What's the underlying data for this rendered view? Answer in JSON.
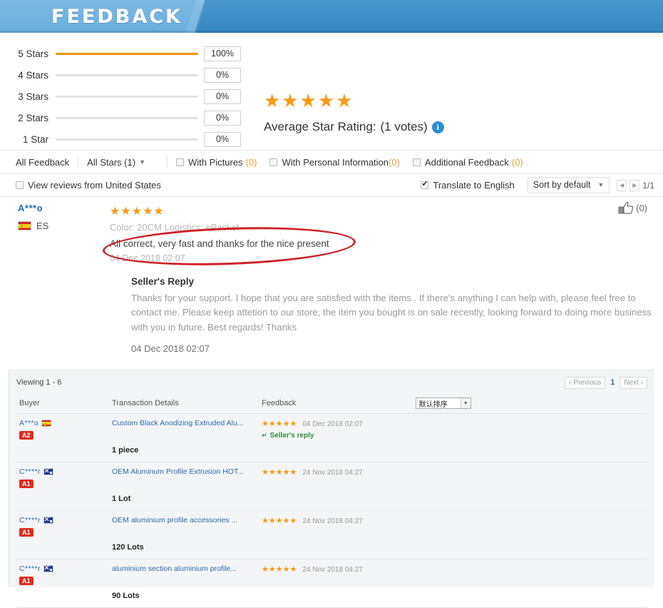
{
  "header": {
    "title": "FEEDBACK",
    "accent": "#3c8dc5",
    "accent_light": "#7cb9e2"
  },
  "summary": {
    "rating_breakdown": [
      {
        "label": "5 Stars",
        "percent_label": "100%",
        "percent": 100
      },
      {
        "label": "4 Stars",
        "percent_label": "0%",
        "percent": 0
      },
      {
        "label": "3 Stars",
        "percent_label": "0%",
        "percent": 0
      },
      {
        "label": "2 Stars",
        "percent_label": "0%",
        "percent": 0
      },
      {
        "label": "1 Star",
        "percent_label": "0%",
        "percent": 0
      }
    ],
    "average_stars": "★★★★★",
    "average_label": "Average Star Rating:",
    "votes_label": "(1 votes)",
    "info_icon": "info-icon",
    "star_color": "#f79a16",
    "bar_color": "#f0920b"
  },
  "filters": {
    "all_feedback": "All Feedback",
    "all_stars": "All Stars (1)",
    "with_pictures": "With Pictures",
    "with_pictures_count": "(0)",
    "with_personal_info": "With Personal Information",
    "with_personal_info_count": "(0)",
    "additional_feedback": "Additional Feedback",
    "additional_feedback_count": "(0)"
  },
  "subbar": {
    "view_reviews_country": "View reviews from United States",
    "translate": "Translate to English",
    "sort": "Sort by default",
    "page_indicator": "1/1"
  },
  "review": {
    "buyer": "A***o",
    "country_code": "ES",
    "stars": "★★★★★",
    "attributes": "Color: 20CM    Logistics: ePacket",
    "text": "All correct, very fast and thanks for the nice present",
    "date": "04 Dec 2018 02:07",
    "helpful_count": "(0)",
    "seller_reply_title": "Seller's Reply",
    "seller_reply_text": "Thanks for your support. I hope that you are satisfied with the items . If there's anything I can help with, please feel free to contact me. Please keep attetion to our store, the item you bought is on sale recently, looking forward to doing more business with you in future. Best regards! Thanks",
    "seller_reply_date": "04 Dec 2018 02:07"
  },
  "table_panel": {
    "viewing": "Viewing 1 - 6",
    "pager": {
      "previous": "Previous",
      "current": "1",
      "next": "Next"
    },
    "sort_select": "默认排序",
    "columns": [
      "Buyer",
      "Transaction Details",
      "Feedback"
    ],
    "rows": [
      {
        "buyer": "A***o",
        "flag": "es",
        "badge": "A2",
        "product": "Custom Black Anodizing Extruded Alu...",
        "quantity": "1 piece",
        "stars": "★★★★★",
        "date": "04 Dec 2018 02:07",
        "seller_reply_link": "Seller's reply"
      },
      {
        "buyer": "C****r",
        "flag": "au",
        "badge": "A1",
        "product": "OEM Aluminum Profile Extrusion HOT...",
        "quantity": "1 Lot",
        "stars": "★★★★★",
        "date": "24 Nov 2018 04:27",
        "seller_reply_link": ""
      },
      {
        "buyer": "C****r",
        "flag": "au",
        "badge": "A1",
        "product": "OEM aluminium profile accessories ...",
        "quantity": "120 Lots",
        "stars": "★★★★★",
        "date": "24 Nov 2018 04:27",
        "seller_reply_link": ""
      },
      {
        "buyer": "C****r",
        "flag": "au",
        "badge": "A1",
        "product": "aluminium section aluminium profile...",
        "quantity": "90 Lots",
        "stars": "★★★★★",
        "date": "24 Nov 2018 04:27",
        "seller_reply_link": ""
      }
    ]
  }
}
